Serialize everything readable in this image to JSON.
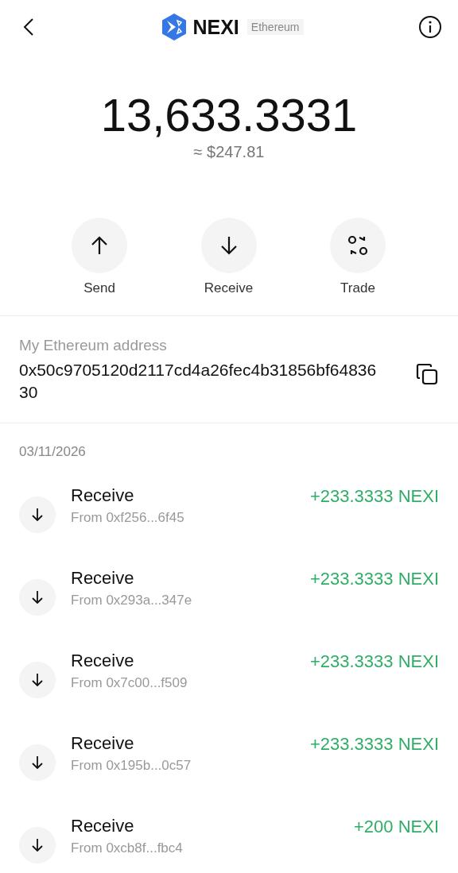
{
  "header": {
    "brand": "NEXI",
    "network": "Ethereum"
  },
  "balance": {
    "amount": "13,633.3331",
    "fiat": "≈ $247.81"
  },
  "actions": [
    {
      "kind": "send",
      "label": "Send"
    },
    {
      "kind": "receive",
      "label": "Receive"
    },
    {
      "kind": "trade",
      "label": "Trade"
    }
  ],
  "address": {
    "label": "My Ethereum address",
    "value": "0x50c9705120d2117cd4a26fec4b31856bf6483630"
  },
  "history": {
    "date": "03/11/2026",
    "transactions": [
      {
        "kind": "receive",
        "title": "Receive",
        "from": "From 0xf256...6f45",
        "amount": "+233.3333 NEXI"
      },
      {
        "kind": "receive",
        "title": "Receive",
        "from": "From 0x293a...347e",
        "amount": "+233.3333 NEXI"
      },
      {
        "kind": "receive",
        "title": "Receive",
        "from": "From 0x7c00...f509",
        "amount": "+233.3333 NEXI"
      },
      {
        "kind": "receive",
        "title": "Receive",
        "from": "From 0x195b...0c57",
        "amount": "+233.3333 NEXI"
      },
      {
        "kind": "receive",
        "title": "Receive",
        "from": "From 0xcb8f...fbc4",
        "amount": "+200 NEXI"
      }
    ]
  }
}
